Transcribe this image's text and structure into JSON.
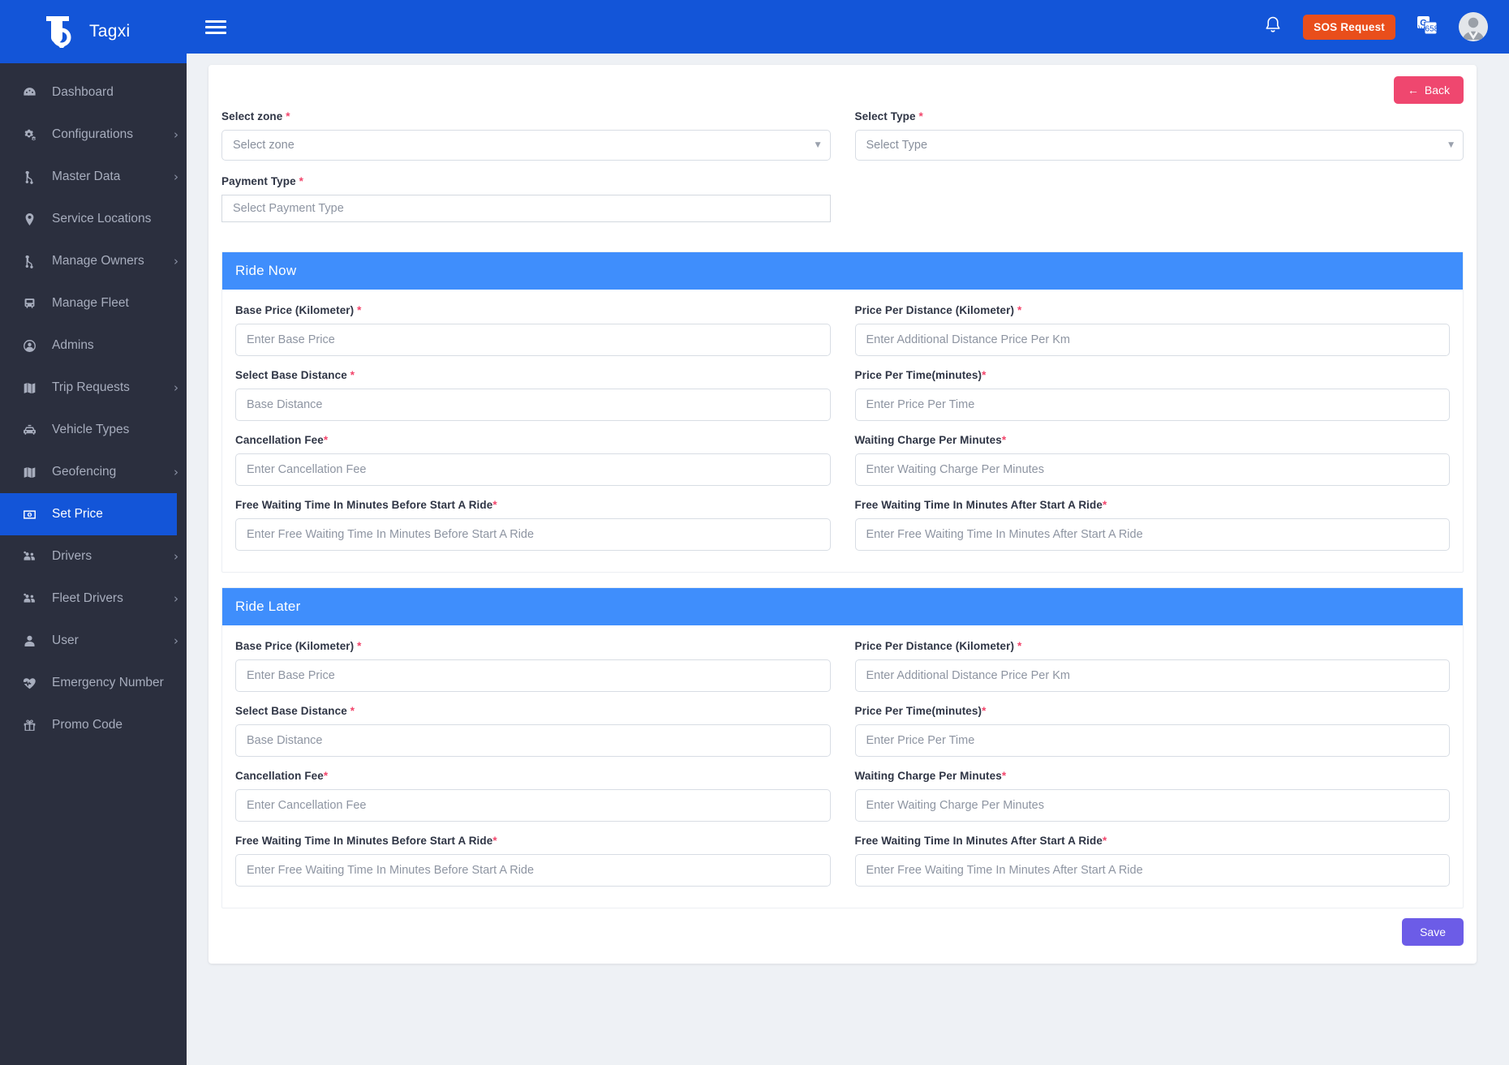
{
  "brand": {
    "name": "Tagxi",
    "logo_icon": "tagxi-logo-icon"
  },
  "topbar": {
    "menu_icon": "hamburger-menu-icon",
    "bell_icon": "notification-bell-icon",
    "sos_label": "SOS Request",
    "translate_icon": "google-translate-icon",
    "avatar_icon": "user-avatar"
  },
  "sidebar": {
    "items": [
      {
        "label": "Dashboard",
        "icon": "dashboard-gauge-icon",
        "caret": "",
        "active": false
      },
      {
        "label": "Configurations",
        "icon": "gears-icon",
        "caret": "›",
        "active": false
      },
      {
        "label": "Master Data",
        "icon": "sitemap-icon",
        "caret": "›",
        "active": false
      },
      {
        "label": "Service Locations",
        "icon": "map-pin-icon",
        "caret": "",
        "active": false
      },
      {
        "label": "Manage Owners",
        "icon": "sitemap-icon",
        "caret": "›",
        "active": false
      },
      {
        "label": "Manage Fleet",
        "icon": "bus-icon",
        "caret": "",
        "active": false
      },
      {
        "label": "Admins",
        "icon": "user-circle-icon",
        "caret": "",
        "active": false
      },
      {
        "label": "Trip Requests",
        "icon": "map-folded-icon",
        "caret": "›",
        "active": false
      },
      {
        "label": "Vehicle Types",
        "icon": "taxi-car-icon",
        "caret": "",
        "active": false
      },
      {
        "label": "Geofencing",
        "icon": "map-folded-icon",
        "caret": "›",
        "active": false
      },
      {
        "label": "Set Price",
        "icon": "money-bill-icon",
        "caret": "",
        "active": true
      },
      {
        "label": "Drivers",
        "icon": "users-group-icon",
        "caret": "›",
        "active": false
      },
      {
        "label": "Fleet Drivers",
        "icon": "users-group-icon",
        "caret": "›",
        "active": false
      },
      {
        "label": "User",
        "icon": "single-user-icon",
        "caret": "›",
        "active": false
      },
      {
        "label": "Emergency Number",
        "icon": "heartbeat-icon",
        "caret": "",
        "active": false
      },
      {
        "label": "Promo Code",
        "icon": "gift-icon",
        "caret": "",
        "active": false
      }
    ]
  },
  "page": {
    "back_label": "Back",
    "back_arrow": "←",
    "save_label": "Save",
    "top_fields": {
      "zone": {
        "label": "Select zone",
        "required": "*",
        "value": "Select zone"
      },
      "type": {
        "label": "Select Type",
        "required": "*",
        "value": "Select Type"
      },
      "payment": {
        "label": "Payment Type",
        "required": "*",
        "placeholder": "Select Payment Type"
      }
    },
    "sections": [
      {
        "title": "Ride Now",
        "left": [
          {
            "label": "Base Price  (Kilometer) ",
            "required": "*",
            "placeholder": "Enter Base Price"
          },
          {
            "label": "Select Base Distance ",
            "required": "*",
            "placeholder": "Base Distance"
          },
          {
            "label": "Cancellation Fee",
            "required": "*",
            "placeholder": "Enter Cancellation Fee"
          },
          {
            "label": "Free Waiting Time In Minutes Before Start A Ride",
            "required": "*",
            "placeholder": "Enter Free Waiting Time In Minutes Before Start A Ride"
          }
        ],
        "right": [
          {
            "label": "Price Per Distance  (Kilometer) ",
            "required": "*",
            "placeholder": "Enter Additional Distance Price Per Km"
          },
          {
            "label": "Price Per Time(minutes)",
            "required": "*",
            "placeholder": "Enter Price Per Time"
          },
          {
            "label": "Waiting Charge Per Minutes",
            "required": "*",
            "placeholder": "Enter Waiting Charge Per Minutes"
          },
          {
            "label": "Free Waiting Time In Minutes After Start A Ride",
            "required": "*",
            "placeholder": "Enter Free Waiting Time In Minutes After Start A Ride"
          }
        ]
      },
      {
        "title": "Ride Later",
        "left": [
          {
            "label": "Base Price  (Kilometer) ",
            "required": "*",
            "placeholder": "Enter Base Price"
          },
          {
            "label": "Select Base Distance ",
            "required": "*",
            "placeholder": "Base Distance"
          },
          {
            "label": "Cancellation Fee",
            "required": "*",
            "placeholder": "Enter Cancellation Fee"
          },
          {
            "label": "Free Waiting Time In Minutes Before Start A Ride",
            "required": "*",
            "placeholder": "Enter Free Waiting Time In Minutes Before Start A Ride"
          }
        ],
        "right": [
          {
            "label": "Price Per Distance  (Kilometer) ",
            "required": "*",
            "placeholder": "Enter Additional Distance Price Per Km"
          },
          {
            "label": "Price Per Time(minutes)",
            "required": "*",
            "placeholder": "Enter Price Per Time"
          },
          {
            "label": "Waiting Charge Per Minutes",
            "required": "*",
            "placeholder": "Enter Waiting Charge Per Minutes"
          },
          {
            "label": "Free Waiting Time In Minutes After Start A Ride",
            "required": "*",
            "placeholder": "Enter Free Waiting Time In Minutes After Start A Ride"
          }
        ]
      }
    ]
  },
  "colors": {
    "brand_blue": "#1355d8",
    "sidebar_dark": "#2b2f3e",
    "panel_blue": "#3f8efc",
    "sos_orange": "#e94e1b",
    "back_pink": "#ef476f",
    "save_purple": "#6c5ce7",
    "required_red": "#f2456b"
  }
}
